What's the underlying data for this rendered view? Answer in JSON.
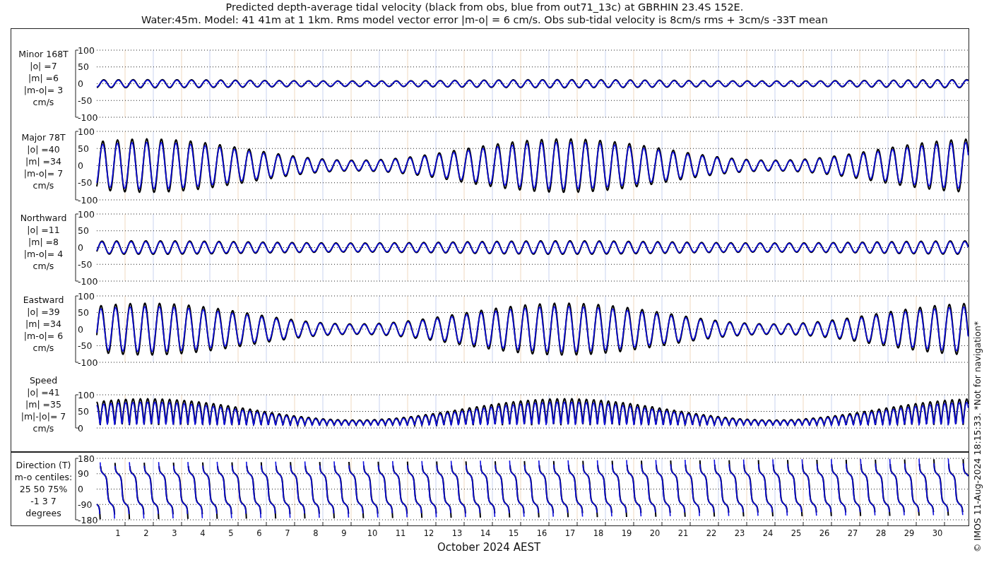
{
  "title": [
    "Predicted depth-average tidal velocity (black from obs, blue from out71_13c) at GBRHIN 23.4S 152E.",
    "Water:45m. Model: 41 41m at 1 1km. Rms model vector error |m-o| = 6 cm/s. Obs sub-tidal velocity is 8cm/s rms + 3cm/s -33T mean"
  ],
  "panels": [
    {
      "kind": "signed",
      "label": [
        "Minor 168T",
        "|o| =7",
        "|m| =6",
        "|m-o|= 3",
        "cm/s"
      ],
      "yticks": [
        "100",
        "50",
        "0",
        "-50",
        "-100"
      ]
    },
    {
      "kind": "signed",
      "label": [
        "Major 78T",
        "|o| =40",
        "|m| =34",
        "|m-o|= 7",
        "cm/s"
      ],
      "yticks": [
        "100",
        "50",
        "0",
        "-50",
        "-100"
      ]
    },
    {
      "kind": "signed",
      "label": [
        "Northward",
        "|o| =11",
        "|m| =8",
        "|m-o|= 4",
        "cm/s"
      ],
      "yticks": [
        "100",
        "50",
        "0",
        "-50",
        "-100"
      ]
    },
    {
      "kind": "signed",
      "label": [
        "Eastward",
        "|o| =39",
        "|m| =34",
        "|m-o|= 6",
        "cm/s"
      ],
      "yticks": [
        "100",
        "50",
        "0",
        "-50",
        "-100"
      ]
    },
    {
      "kind": "speed",
      "label": [
        "Speed",
        "|o| =41",
        "|m| =35",
        "|m|-|o|= 7",
        "cm/s"
      ],
      "yticks": [
        "100",
        "50",
        "0"
      ]
    },
    {
      "kind": "direction",
      "label": [
        "Direction (T)",
        "m-o centiles:",
        "25  50  75%",
        "-1  3  7",
        "degrees"
      ],
      "yticks": [
        "180",
        "90",
        "0",
        "-90",
        "-180"
      ]
    }
  ],
  "xaxis": {
    "days": [
      "1",
      "2",
      "3",
      "4",
      "5",
      "6",
      "7",
      "8",
      "9",
      "10",
      "11",
      "12",
      "13",
      "14",
      "15",
      "16",
      "17",
      "18",
      "19",
      "20",
      "21",
      "22",
      "23",
      "24",
      "25",
      "26",
      "27",
      "28",
      "29",
      "30"
    ],
    "label": "October 2024 AEST"
  },
  "footer": "© IMOS 11-Aug-2024 18:15:33. *Not for navigation*"
}
